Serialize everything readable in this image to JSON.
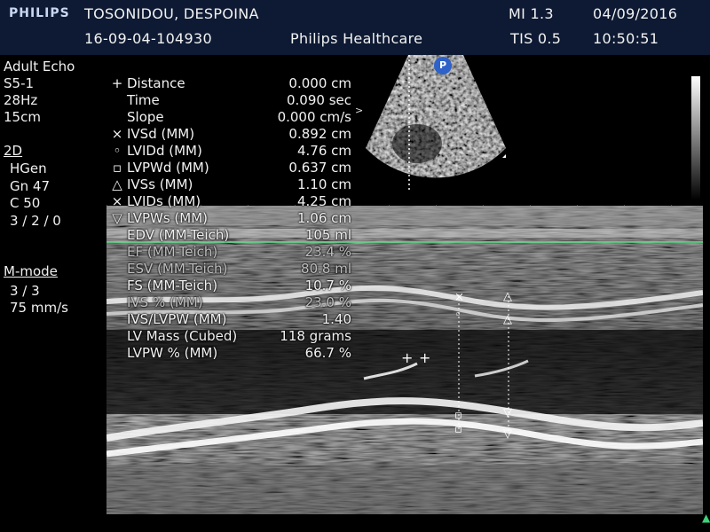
{
  "header": {
    "brand": "PHILIPS",
    "patient_name": "TOSONIDOU, DESPOINA",
    "study_id": "16-09-04-104930",
    "institution": "Philips Healthcare",
    "mi": "MI 1.3",
    "tis": "TIS 0.5",
    "date": "04/09/2016",
    "time": "10:50:51"
  },
  "left_panel": {
    "preset": "Adult Echo",
    "probe": "S5-1",
    "frame_rate": "28Hz",
    "depth": "15cm",
    "mode_2d": "2D",
    "hgen": "HGen",
    "gain": "Gn 47",
    "compress": "C 50",
    "persist": "3 / 2 / 0",
    "mmode": "M-mode",
    "mmode_setting": "3 / 3",
    "sweep_speed": "75 mm/s"
  },
  "badge": "P",
  "measurements": [
    {
      "symbol": "+",
      "label": "Distance",
      "value": "0.000 cm"
    },
    {
      "symbol": "",
      "label": "Time",
      "value": "0.090 sec"
    },
    {
      "symbol": "",
      "label": "Slope",
      "value": "0.000 cm/s"
    },
    {
      "symbol": "×",
      "label": "IVSd (MM)",
      "value": "0.892 cm"
    },
    {
      "symbol": "◦",
      "label": "LVIDd (MM)",
      "value": "4.76 cm"
    },
    {
      "symbol": "▫",
      "label": "LVPWd (MM)",
      "value": "0.637 cm"
    },
    {
      "symbol": "△",
      "label": "IVSs (MM)",
      "value": "1.10 cm"
    },
    {
      "symbol": "×",
      "label": "LVIDs (MM)",
      "value": "4.25 cm"
    },
    {
      "symbol": "▽",
      "label": "LVPWs (MM)",
      "value": "1.06 cm"
    },
    {
      "symbol": "",
      "label": "EDV (MM-Teich)",
      "value": "105 ml"
    },
    {
      "symbol": "",
      "label": "EF (MM-Teich)",
      "value": "23.4 %"
    },
    {
      "symbol": "",
      "label": "ESV (MM-Teich)",
      "value": "80.8 ml"
    },
    {
      "symbol": "",
      "label": "FS (MM-Teich)",
      "value": "10.7 %"
    },
    {
      "symbol": "",
      "label": "IVS % (MM)",
      "value": "23.0 %"
    },
    {
      "symbol": "",
      "label": "IVS/LVPW (MM)",
      "value": "1.40"
    },
    {
      "symbol": "",
      "label": "LV Mass (Cubed)",
      "value": "118 grams"
    },
    {
      "symbol": "",
      "label": "LVPW % (MM)",
      "value": "66.7 %"
    }
  ],
  "colors": {
    "header_bg": "#0e1a33",
    "ecg_trace": "#5fe08a",
    "badge": "#2f62c8"
  }
}
